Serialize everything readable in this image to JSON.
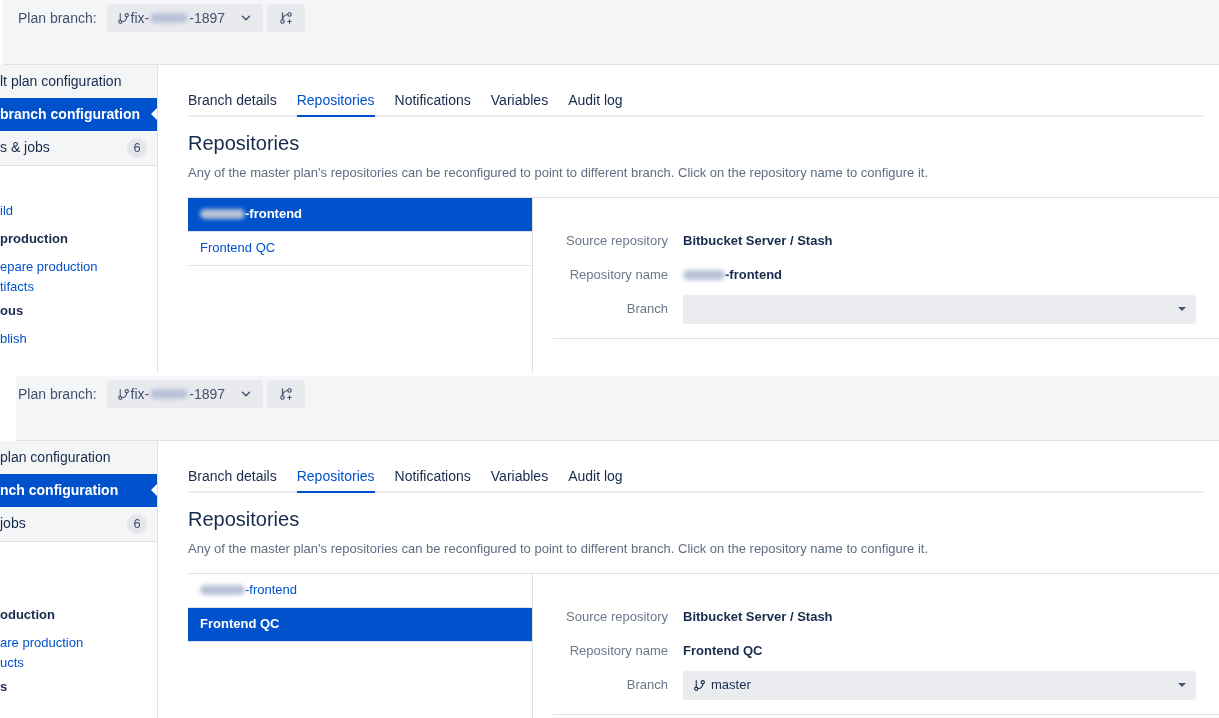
{
  "panels": [
    {
      "plan_branch_label": "Plan branch:",
      "branch": {
        "prefix": "fix-",
        "redacted": true,
        "suffix": "-1897"
      },
      "sidebar": {
        "items": [
          {
            "text": "lt plan configuration",
            "selected": false
          },
          {
            "text": "branch configuration",
            "selected": true
          },
          {
            "text": "s & jobs",
            "selected": false,
            "badge": "6"
          }
        ],
        "entries": [
          {
            "kind": "job",
            "lines": [
              "ild"
            ]
          },
          {
            "kind": "stage",
            "lines": [
              "production"
            ]
          },
          {
            "kind": "job",
            "lines": [
              "epare production",
              "tifacts"
            ]
          },
          {
            "kind": "stage",
            "lines": [
              "ous"
            ]
          },
          {
            "kind": "job",
            "lines": [
              "blish"
            ]
          }
        ]
      },
      "tabs": [
        {
          "label": "Branch details",
          "selected": false
        },
        {
          "label": "Repositories",
          "selected": true
        },
        {
          "label": "Notifications",
          "selected": false
        },
        {
          "label": "Variables",
          "selected": false
        },
        {
          "label": "Audit log",
          "selected": false
        }
      ],
      "heading": "Repositories",
      "description": "Any of the master plan's repositories can be reconfigured to point to different branch. Click on the repository name to configure it.",
      "repositories": [
        {
          "name": "-frontend",
          "redacted": true,
          "selected": true
        },
        {
          "name": "Frontend QC",
          "redacted": false,
          "selected": false
        }
      ],
      "details": [
        {
          "kind": "text",
          "label": "Source repository",
          "value": "Bitbucket Server / Stash",
          "redacted": false
        },
        {
          "kind": "text",
          "label": "Repository name",
          "value": "-frontend",
          "redacted": true
        },
        {
          "kind": "select",
          "label": "Branch"
        }
      ]
    },
    {
      "plan_branch_label": "Plan branch:",
      "branch": {
        "prefix": "fix-",
        "redacted": true,
        "suffix": "-1897"
      },
      "sidebar": {
        "items": [
          {
            "text": "plan configuration",
            "selected": false
          },
          {
            "text": "nch configuration",
            "selected": true
          },
          {
            "text": "jobs",
            "selected": false,
            "badge": "6"
          }
        ],
        "entries": [
          {
            "kind": "stage",
            "lines": [
              "oduction"
            ]
          },
          {
            "kind": "job",
            "lines": [
              "are production",
              "ucts"
            ]
          },
          {
            "kind": "stage",
            "lines": [
              "s"
            ]
          }
        ]
      },
      "tabs": [
        {
          "label": "Branch details",
          "selected": false
        },
        {
          "label": "Repositories",
          "selected": true
        },
        {
          "label": "Notifications",
          "selected": false
        },
        {
          "label": "Variables",
          "selected": false
        },
        {
          "label": "Audit log",
          "selected": false
        }
      ],
      "heading": "Repositories",
      "description": "Any of the master plan's repositories can be reconfigured to point to different branch. Click on the repository name to configure it.",
      "repositories": [
        {
          "name": "-frontend",
          "redacted": true,
          "selected": false
        },
        {
          "name": "Frontend QC",
          "redacted": false,
          "selected": true
        }
      ],
      "details": [
        {
          "kind": "text",
          "label": "Source repository",
          "value": "Bitbucket Server / Stash",
          "redacted": false
        },
        {
          "kind": "text",
          "label": "Repository name",
          "value": "Frontend QC",
          "redacted": false
        },
        {
          "kind": "select",
          "label": "Branch",
          "value": "master"
        }
      ]
    }
  ]
}
